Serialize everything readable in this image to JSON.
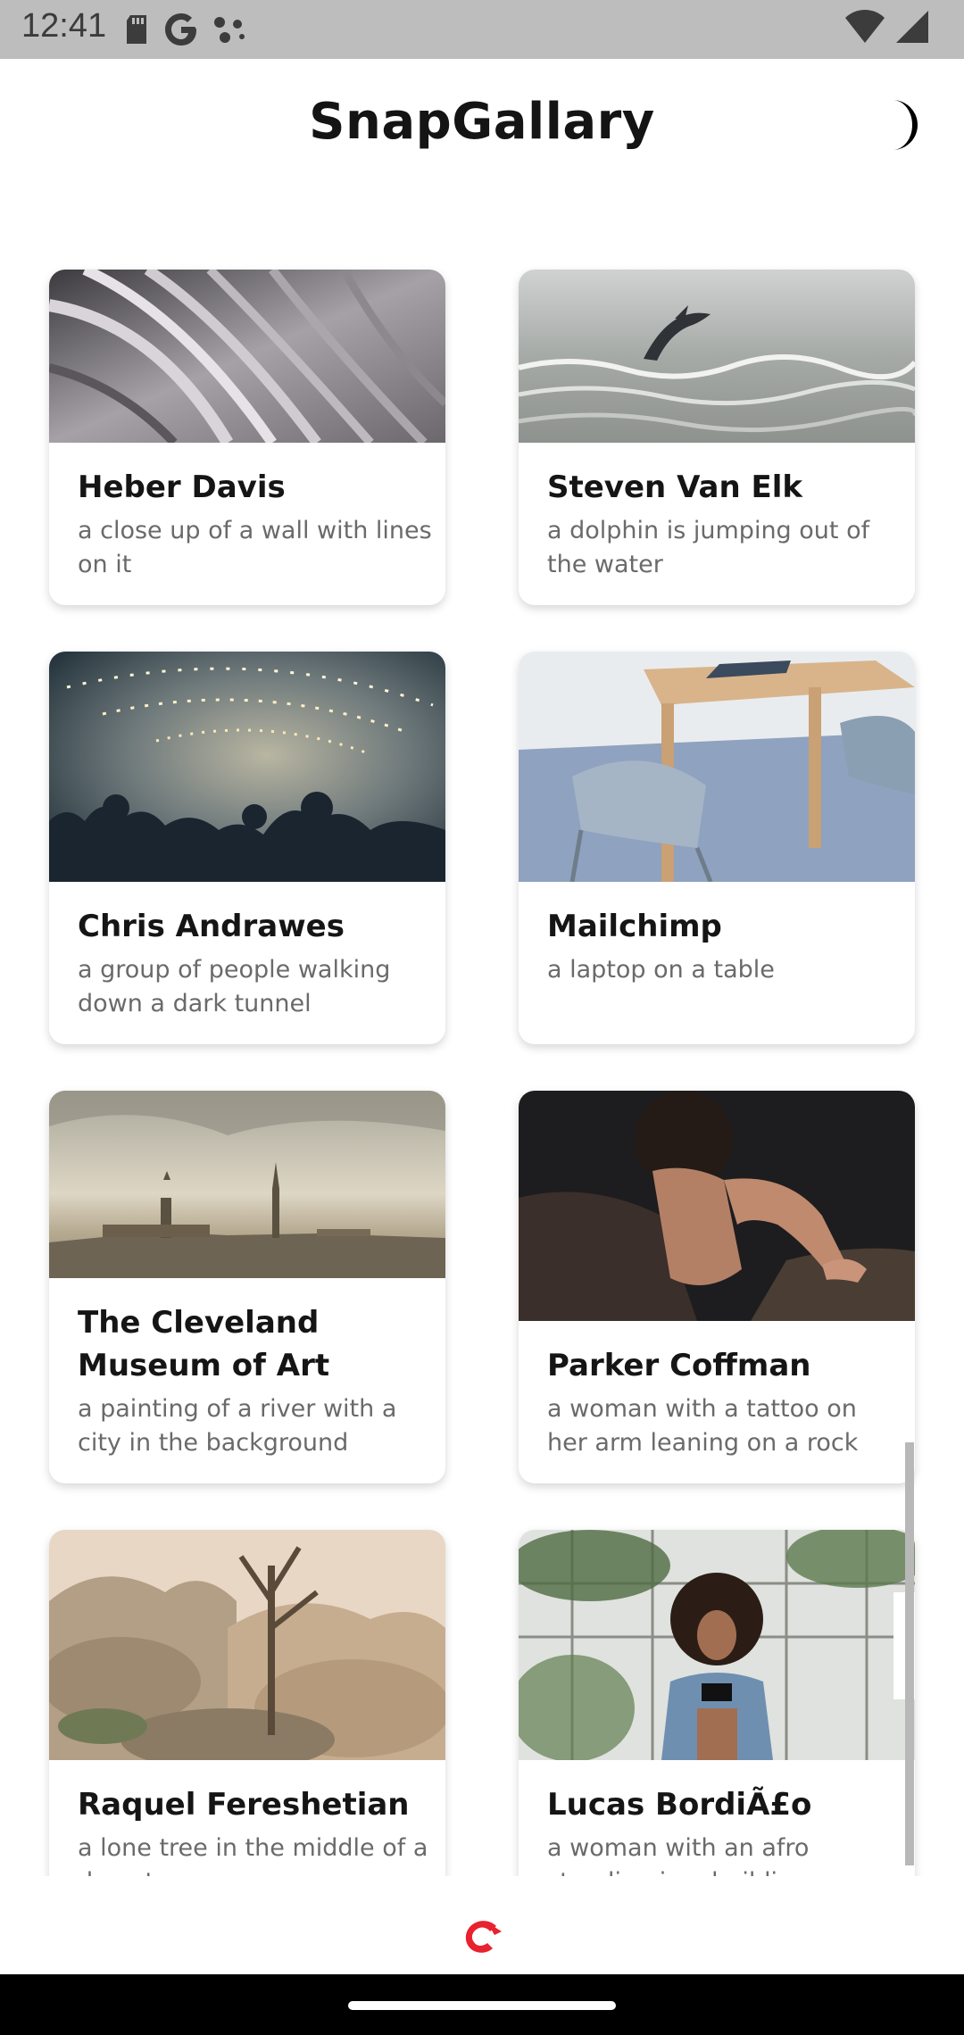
{
  "status_bar": {
    "time": "12:41",
    "left_icons": [
      "sd-card-icon",
      "google-icon",
      "assistant-dots-icon"
    ],
    "right_icons": [
      "wifi-icon",
      "cell-signal-icon"
    ]
  },
  "header": {
    "title": "SnapGallary",
    "theme_toggle_icon": "moon-icon"
  },
  "cards": [
    {
      "title": "Heber Davis",
      "description": "a close up of a wall with lines on it"
    },
    {
      "title": "Steven Van Elk",
      "description": "a dolphin is jumping out of the water"
    },
    {
      "title": "Chris Andrawes",
      "description": "a group of people walking down a dark tunnel"
    },
    {
      "title": "Mailchimp",
      "description": "a laptop on a table"
    },
    {
      "title": "The Cleveland Museum of Art",
      "description": "a painting of a river with a city in the background"
    },
    {
      "title": "Parker Coffman",
      "description": "a woman with a tattoo on her arm leaning on a rock"
    },
    {
      "title": "Raquel Fereshetian",
      "description": "a lone tree in the middle of a desert"
    },
    {
      "title": "Lucas BordiÃ£o",
      "description": "a woman with an afro standing in a building"
    }
  ],
  "footer": {
    "logo_icon": "brand-logo-icon"
  },
  "colors": {
    "brand_red": "#e8222e",
    "status_bar_bg": "#bdbdbd",
    "card_title": "#151515",
    "card_desc": "#6a6a6a"
  }
}
